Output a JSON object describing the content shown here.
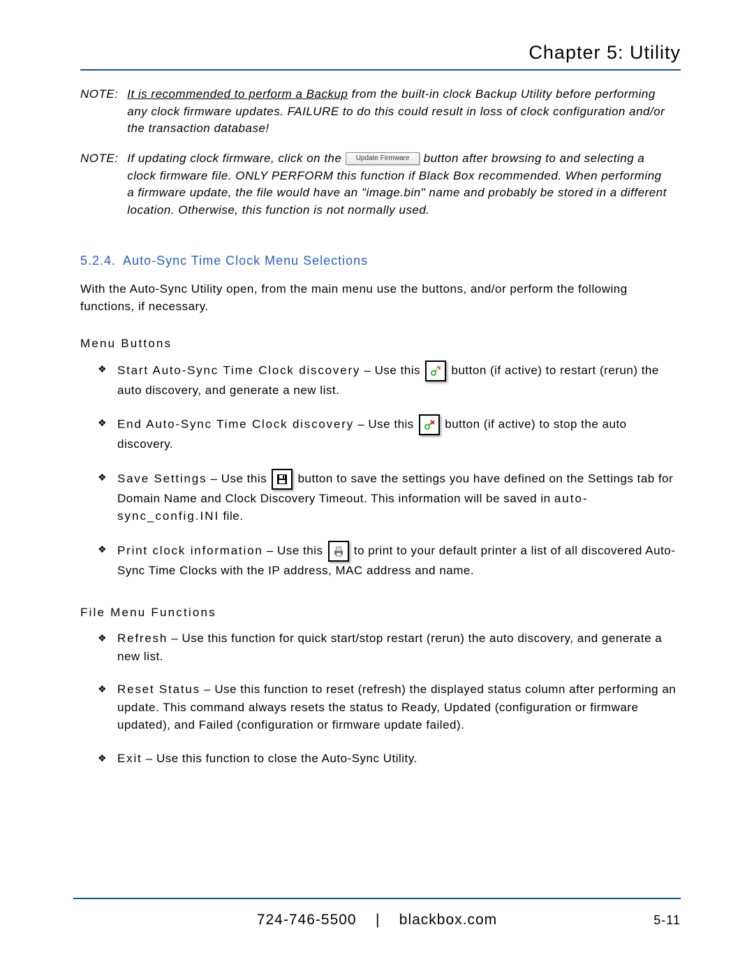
{
  "chapter_title": "Chapter 5: Utility",
  "notes": [
    {
      "label": "NOTE:",
      "pre": "",
      "underlined": "It is recommended to perform a Backup",
      "post": " from the built-in clock Backup Utility before performing any clock firmware updates. FAILURE to do this could result in loss of clock configuration and/or the transaction database!"
    },
    {
      "label": "NOTE:",
      "pre": "If updating clock firmware, click on the ",
      "button": "Update Firmware",
      "post": " button after browsing to and selecting a clock firmware file. ONLY PERFORM this function if Black Box recommended. When performing a firmware update, the file would have an \"image.bin\" name and probably be stored in a different location. Otherwise, this function is not normally used."
    }
  ],
  "section": {
    "number": "5.2.4.",
    "title": "Auto-Sync Time Clock Menu Selections"
  },
  "intro": "With the Auto-Sync Utility open, from the main menu use the buttons, and/or perform the following functions, if necessary.",
  "menu_buttons_heading": "Menu Buttons",
  "menu_buttons": [
    {
      "lead": "Start Auto-Sync Time Clock discovery",
      "before": " – Use this ",
      "icon": "discover-start",
      "after": " button (if active) to restart (rerun) the auto discovery, and generate a new list."
    },
    {
      "lead": "End Auto-Sync Time Clock discovery",
      "before": " – Use this ",
      "icon": "discover-end",
      "after": " button (if active) to stop the auto discovery."
    },
    {
      "lead": "Save Settings",
      "before": " – Use this ",
      "icon": "save",
      "after_before_tracked": " button to save the settings you have defined on the Settings tab for Domain Name and Clock Discovery Timeout. This information will be saved in ",
      "tracked": "auto-sync_config.INI",
      "after": " file."
    },
    {
      "lead": "Print clock information",
      "before": " – Use this ",
      "icon": "print",
      "after": " to print to your default printer a list of all discovered Auto-Sync Time Clocks with the IP address, MAC address and name."
    }
  ],
  "file_menu_heading": "File Menu Functions",
  "file_menu": [
    {
      "lead": "Refresh",
      "rest": " – Use this function for quick start/stop restart (rerun) the auto discovery, and generate a new list."
    },
    {
      "lead": "Reset Status",
      "rest": " – Use this function to reset (refresh) the displayed status column after performing an update. This command always resets the status to Ready, Updated (configuration or firmware updated), and Failed (configuration or firmware update failed)."
    },
    {
      "lead": "Exit",
      "rest": " – Use this function to close the Auto-Sync Utility."
    }
  ],
  "footer": {
    "phone": "724-746-5500",
    "sep": "|",
    "site": "blackbox.com",
    "page": "5-11"
  }
}
